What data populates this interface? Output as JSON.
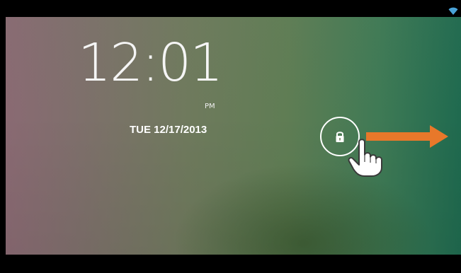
{
  "lockscreen": {
    "time": "12:01",
    "ampm": "PM",
    "date": "TUE 12/17/2013"
  },
  "icons": {
    "status": "wifi-icon",
    "lock": "lock-icon",
    "gesture": "hand-pointer-icon",
    "direction": "arrow-right-icon"
  },
  "colors": {
    "arrow": "#e8782a",
    "text": "#ffffff",
    "status_icon": "#4aa3d8"
  }
}
